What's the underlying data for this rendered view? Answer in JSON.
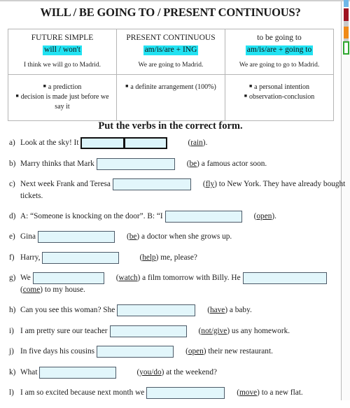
{
  "title": "WILL / BE GOING TO / PRESENT CONTINUOUS?",
  "grammar_table": {
    "columns": [
      {
        "name": "FUTURE SIMPLE",
        "formula": "will / won't",
        "example": "I think we will go to Madrid.",
        "uses": [
          "a prediction",
          "decision is made just before we say it"
        ]
      },
      {
        "name": "PRESENT CONTINUOUS",
        "formula": "am/is/are + ING",
        "example": "We are going to Madrid.",
        "uses": [
          "a definite arrangement (100%)"
        ]
      },
      {
        "name": "to be going to",
        "formula": "am/is/are + going to",
        "example": "We are going to go to Madrid.",
        "uses": [
          "a personal intention",
          "observation-conclusion"
        ]
      }
    ],
    "highlight_color": "#22e2f2"
  },
  "instruction": "Put the verbs in the correct form.",
  "exercises": [
    {
      "label": "a)",
      "before": "Look at  the sky! It",
      "cue": "(rain)",
      "after": ".",
      "blank_width": 62,
      "blank_width_2": 62,
      "focused": true,
      "two_blanks": true
    },
    {
      "label": "b)",
      "before": "Marry thinks that Mark",
      "cue": "(be)",
      "after": " a famous actor soon.",
      "blank_width": 112,
      "focused": false
    },
    {
      "label": "c)",
      "before": "Next week Frank and Teresa",
      "cue": "(fly)",
      "after": " to New York. They have already bought tickets.",
      "blank_width": 112,
      "focused": false
    },
    {
      "label": "d)",
      "before": "A: “Someone is knocking on the door”.  B: “I",
      "cue": "(open)",
      "after": ".",
      "blank_width": 110,
      "focused": false
    },
    {
      "label": "e)",
      "before": "Gina",
      "cue": "(be)",
      "after": " a doctor when she grows up.",
      "blank_width": 110,
      "focused": false
    },
    {
      "label": "f)",
      "before": "Harry,",
      "cue": "(help)",
      "after": " me, please?",
      "blank_width": 110,
      "focused": false
    },
    {
      "label": "g)",
      "before": "We",
      "cue": "(watch)",
      "after": " a film tomorrow with Billy. He",
      "cue2": "(come)",
      "after2": " to my house.",
      "blank_width": 102,
      "blank_width_2": 120,
      "focused": false,
      "trailing_blank": true
    },
    {
      "label": "h)",
      "before": "Can you see this woman? She",
      "cue": "(have)",
      "after": " a baby.",
      "blank_width": 112,
      "focused": false
    },
    {
      "label": "i)",
      "before": "I am pretty sure our teacher",
      "cue": "(not/give)",
      "after": " us any homework.",
      "blank_width": 110,
      "focused": false
    },
    {
      "label": "j)",
      "before": "In five days his cousins",
      "cue": "(open)",
      "after": " their new restaurant.",
      "blank_width": 110,
      "focused": false
    },
    {
      "label": "k)",
      "before": "What",
      "cue": "(you/do)",
      "after": " at  the weekend?",
      "blank_width": 110,
      "focused": false
    },
    {
      "label": "l)",
      "before": "I am so excited because next month we",
      "cue": "(move)",
      "after": " to a new flat.",
      "blank_width": 112,
      "focused": false
    }
  ],
  "edge_chips": [
    {
      "name": "blue-chip",
      "color": "#6fb7e8"
    },
    {
      "name": "red-chip",
      "color": "#9e1220"
    },
    {
      "name": "gray-chip",
      "color": "#c9c9c9"
    },
    {
      "name": "orange-chip",
      "color": "#f08a18"
    },
    {
      "name": "green-chip",
      "color": "#2fa82f"
    }
  ]
}
